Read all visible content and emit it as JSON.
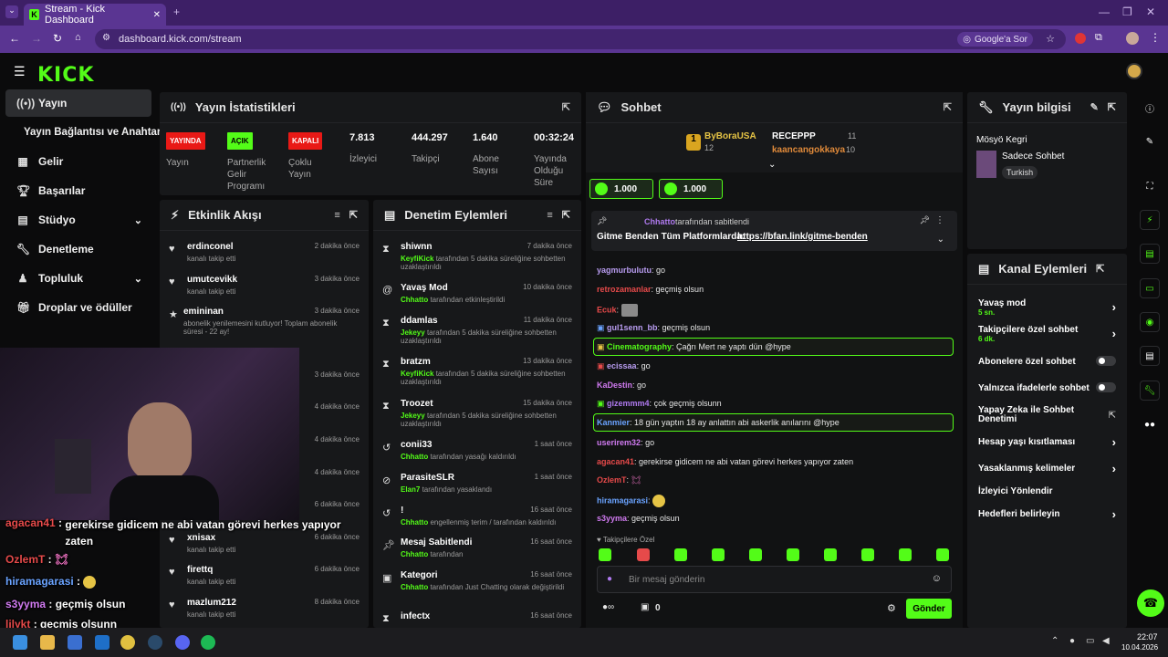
{
  "browser": {
    "tab_title": "Stream - Kick Dashboard",
    "url": "dashboard.kick.com/stream",
    "google_btn": "Google'a Sor"
  },
  "sidebar": {
    "items": [
      {
        "label": "Yayın"
      },
      {
        "label": "Yayın Bağlantısı ve Anahtarı"
      },
      {
        "label": "Gelir"
      },
      {
        "label": "Başarılar"
      },
      {
        "label": "Stüdyo"
      },
      {
        "label": "Denetleme"
      },
      {
        "label": "Topluluk"
      },
      {
        "label": "Droplar ve ödüller"
      }
    ]
  },
  "stats": {
    "title": "Yayın İstatistikleri",
    "badges": [
      {
        "text": "YAYINDA",
        "label": "Yayın"
      },
      {
        "text": "AÇIK",
        "label": "Partnerlik Gelir Programı"
      },
      {
        "text": "KAPALI",
        "label": "Çoklu Yayın"
      }
    ],
    "items": [
      {
        "value": "7.813",
        "label": "İzleyici"
      },
      {
        "value": "444.297",
        "label": "Takipçi"
      },
      {
        "value": "1.640",
        "label": "Abone Sayısı"
      },
      {
        "value": "00:32:24",
        "label": "Yayında Olduğu Süre"
      }
    ]
  },
  "activity": {
    "title": "Etkinlik Akışı",
    "items": [
      {
        "name": "erdinconel",
        "sub": "kanalı takip etti",
        "time": "2 dakika önce"
      },
      {
        "name": "umutcevikk",
        "sub": "kanalı takip etti",
        "time": "3 dakika önce"
      },
      {
        "name": "emininan",
        "sub": "abonelik yenilemesini kutluyor! Toplam abonelik süresi - 22 ay!",
        "time": "3 dakika önce"
      },
      {
        "name": "",
        "sub": "",
        "time": "3 dakika önce"
      },
      {
        "name": "",
        "sub": "",
        "time": "4 dakika önce"
      },
      {
        "name": "",
        "sub": "",
        "time": "4 dakika önce"
      },
      {
        "name": "",
        "sub": "",
        "time": "4 dakika önce"
      },
      {
        "name": "",
        "sub": "",
        "time": "6 dakika önce"
      },
      {
        "name": "xnisax",
        "sub": "kanalı takip etti",
        "time": "6 dakika önce"
      },
      {
        "name": "firettq",
        "sub": "kanalı takip etti",
        "time": "6 dakika önce"
      },
      {
        "name": "mazlum212",
        "sub": "kanalı takip etti",
        "time": "8 dakika önce"
      }
    ]
  },
  "moderation": {
    "title": "Denetim Eylemleri",
    "items": [
      {
        "name": "shiwnn",
        "actor": "KeyfiKick",
        "sub": "tarafından 5 dakika süreliğine sohbetten uzaklaştırıldı",
        "time": "7 dakika önce"
      },
      {
        "name": "Yavaş Mod",
        "actor": "Chhatto",
        "sub": "tarafından etkinleştirildi",
        "time": "10 dakika önce"
      },
      {
        "name": "ddamlas",
        "actor": "Jekeyy",
        "sub": "tarafından 5 dakika süreliğine sohbetten uzaklaştırıldı",
        "time": "11 dakika önce"
      },
      {
        "name": "bratzm",
        "actor": "KeyfiKick",
        "sub": "tarafından 5 dakika süreliğine sohbetten uzaklaştırıldı",
        "time": "13 dakika önce"
      },
      {
        "name": "Troozet",
        "actor": "Jekeyy",
        "sub": "tarafından 5 dakika süreliğine sohbetten uzaklaştırıldı",
        "time": "15 dakika önce"
      },
      {
        "name": "conii33",
        "actor": "Chhatto",
        "sub": "tarafından yasağı kaldırıldı",
        "time": "1 saat önce"
      },
      {
        "name": "ParasiteSLR",
        "actor": "Elan7",
        "sub": "tarafından yasaklandı",
        "time": "1 saat önce"
      },
      {
        "name": "!",
        "actor": "Chhatto",
        "sub": "engellenmiş terim / tarafından kaldırıldı",
        "time": "16 saat önce"
      },
      {
        "name": "Mesaj Sabitlendi",
        "actor": "Chhatto",
        "sub": "tarafından",
        "time": "16 saat önce"
      },
      {
        "name": "Kategori",
        "actor": "Chhatto",
        "sub": "tarafından Just Chatting olarak değiştirildi",
        "time": "16 saat önce"
      },
      {
        "name": "infectx",
        "actor": "",
        "sub": "",
        "time": "16 saat önce"
      }
    ]
  },
  "chat": {
    "title": "Sohbet",
    "top": [
      {
        "name": "ByBoraUSA",
        "count": "12"
      },
      {
        "name": "RECEPPP",
        "count": "11"
      },
      {
        "name": "kaancangokkaya",
        "count": "10"
      }
    ],
    "goals": [
      "1.000",
      "1.000"
    ],
    "pinned_by": "Chhatto",
    "pinned_label": "tarafından sabitlendi",
    "pinned_text": "Gitme Benden Tüm Platformlarda:",
    "pinned_link": "https://bfan.link/gitme-benden",
    "messages": [
      {
        "user": "yagmurbulutu",
        "text": "go",
        "color": "#b89cf0"
      },
      {
        "user": "retrozamanlar",
        "text": "geçmiş olsun",
        "color": "#e64a4a"
      },
      {
        "user": "Ecuk",
        "text": "",
        "color": "#e64a4a"
      },
      {
        "user": "gul1senn_bb",
        "text": "geçmiş olsun",
        "color": "#b89cf0"
      },
      {
        "user": "Cinematography",
        "text": "Çağrı Mert ne yaptı dün @hype",
        "color": "#53fc18"
      },
      {
        "user": "ecissaa",
        "text": "go",
        "color": "#b89cf0"
      },
      {
        "user": "KaDestin",
        "text": "go",
        "color": "#d07af0"
      },
      {
        "user": "gizemmm4",
        "text": "çok geçmiş olsunn",
        "color": "#b07af0"
      },
      {
        "user": "Kanmier",
        "text": "18 gün yaptın 18 ay anlattın abi askerlik anılarını @hype",
        "color": "#6aa3ff"
      },
      {
        "user": "userirem32",
        "text": "go",
        "color": "#d07af0"
      },
      {
        "user": "agacan41",
        "text": "gerekirse gidicem ne abi vatan görevi herkes yapıyor zaten",
        "color": "#e64a4a"
      },
      {
        "user": "OzlemT",
        "text": "",
        "color": "#e64a4a"
      },
      {
        "user": "hiramagarasi",
        "text": "",
        "color": "#6aa3ff"
      },
      {
        "user": "s3yyma",
        "text": "geçmiş olsun",
        "color": "#d07af0"
      }
    ],
    "followers_only": "Takipçilere Özel",
    "placeholder": "Bir mesaj gönderin",
    "points": "0",
    "send": "Gönder"
  },
  "info": {
    "title": "Yayın bilgisi",
    "stream_title": "Mösyö Kegri",
    "category": "Sadece Sohbet",
    "tag": "Turkish"
  },
  "actions": {
    "title": "Kanal Eylemleri",
    "items": [
      {
        "label": "Yavaş mod",
        "sub": "5 sn."
      },
      {
        "label": "Takipçilere özel sohbet",
        "sub": "6 dk."
      },
      {
        "label": "Abonelere özel sohbet",
        "sub": ""
      },
      {
        "label": "Yalnızca ifadelerle sohbet",
        "sub": ""
      },
      {
        "label": "Yapay Zeka ile Sohbet Denetimi",
        "sub": ""
      },
      {
        "label": "Hesap yaşı kısıtlaması",
        "sub": ""
      },
      {
        "label": "Yasaklanmış kelimeler",
        "sub": ""
      },
      {
        "label": "İzleyici Yönlendir",
        "sub": ""
      },
      {
        "label": "Hedefleri belirleyin",
        "sub": ""
      }
    ]
  },
  "overlay": {
    "lines": [
      {
        "user": "agacan41",
        "text": "gerekirse gidicem ne abi vatan görevi herkes yapıyor zaten"
      },
      {
        "user": "OzlemT",
        "text": ""
      },
      {
        "user": "hiramagarasi",
        "text": ""
      },
      {
        "user": "s3yyma",
        "text": "geçmiş olsun"
      },
      {
        "user": "lilykt",
        "text": "geçmiş olsunn"
      }
    ]
  },
  "taskbar": {
    "time": "22:07",
    "date": "10.04.2026"
  },
  "colors": {
    "accent": "#53fc18",
    "live": "#e91916"
  }
}
